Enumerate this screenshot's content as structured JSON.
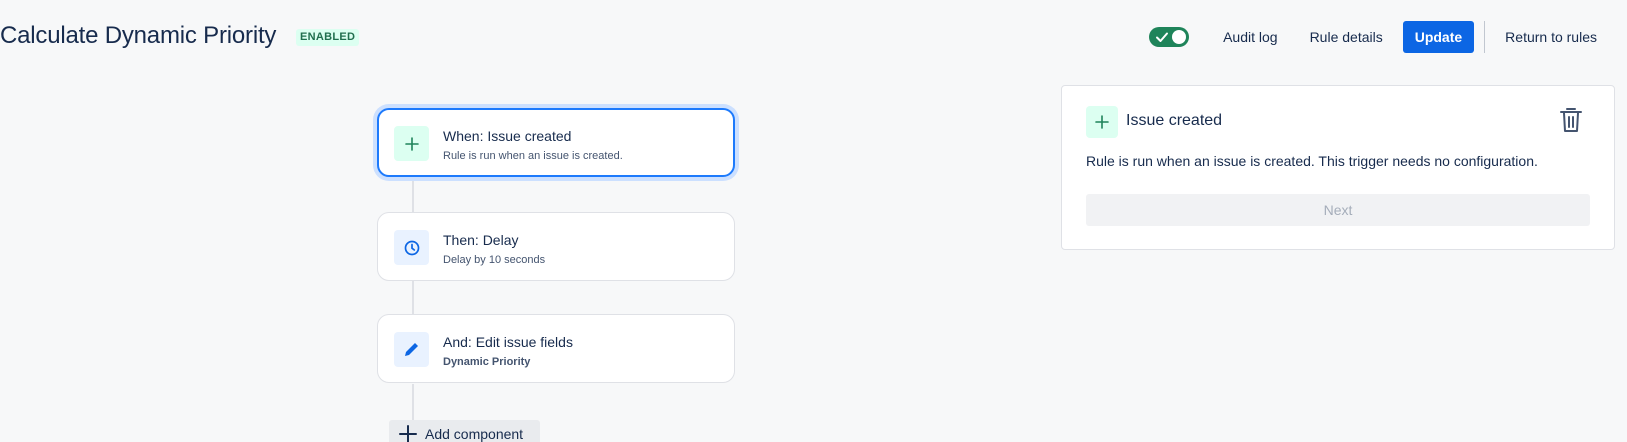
{
  "header": {
    "rule_title": "Calculate Dynamic Priority",
    "status_badge": "ENABLED",
    "toggle_on": true,
    "audit_log": "Audit log",
    "rule_details": "Rule details",
    "update": "Update",
    "return_to_rules": "Return to rules"
  },
  "flow": {
    "components": [
      {
        "title": "When: Issue created",
        "subtitle": "Rule is run when an issue is created.",
        "icon": "plus-icon",
        "selected": true
      },
      {
        "title": "Then: Delay",
        "subtitle": "Delay by 10 seconds",
        "icon": "clock-icon",
        "selected": false
      },
      {
        "title": "And: Edit issue fields",
        "subtitle": "Dynamic Priority",
        "icon": "pencil-icon",
        "selected": false
      }
    ],
    "add_component": "Add component"
  },
  "panel": {
    "title": "Issue created",
    "description": "Rule is run when an issue is created. This trigger needs no configuration.",
    "next": "Next"
  },
  "colors": {
    "primary": "#0c66e4",
    "toggle_on": "#1f845a",
    "badge_bg": "#dcfff1",
    "badge_text": "#216e4e",
    "selected_border": "#1d7afc"
  }
}
